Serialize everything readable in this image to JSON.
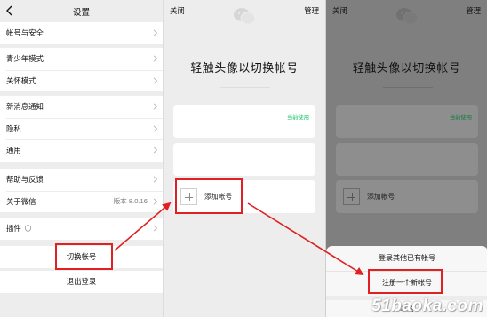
{
  "settings": {
    "title": "设置",
    "group1": [
      "帐号与安全"
    ],
    "group2": [
      "青少年模式",
      "关怀模式"
    ],
    "group3": [
      "新消息通知",
      "隐私",
      "通用"
    ],
    "group4": [
      {
        "label": "帮助与反馈",
        "value": ""
      },
      {
        "label": "关于微信",
        "value": "版本 8.0.16"
      }
    ],
    "plugins": "插件",
    "switch_account": "切换帐号",
    "logout": "退出登录"
  },
  "switch_screen": {
    "close": "关闭",
    "manage": "管理",
    "title": "轻触头像以切换帐号",
    "current_use": "当前使用",
    "add_account": "添加帐号"
  },
  "action_sheet": {
    "login_existing": "登录其他已有帐号",
    "register_new": "注册一个新帐号",
    "cancel": "取消"
  },
  "watermark": "51baoka.com",
  "colors": {
    "highlight": "#e02121",
    "accent_green": "#07c160",
    "page_bg": "#ededed",
    "dim_overlay": "#7f7f7f"
  }
}
